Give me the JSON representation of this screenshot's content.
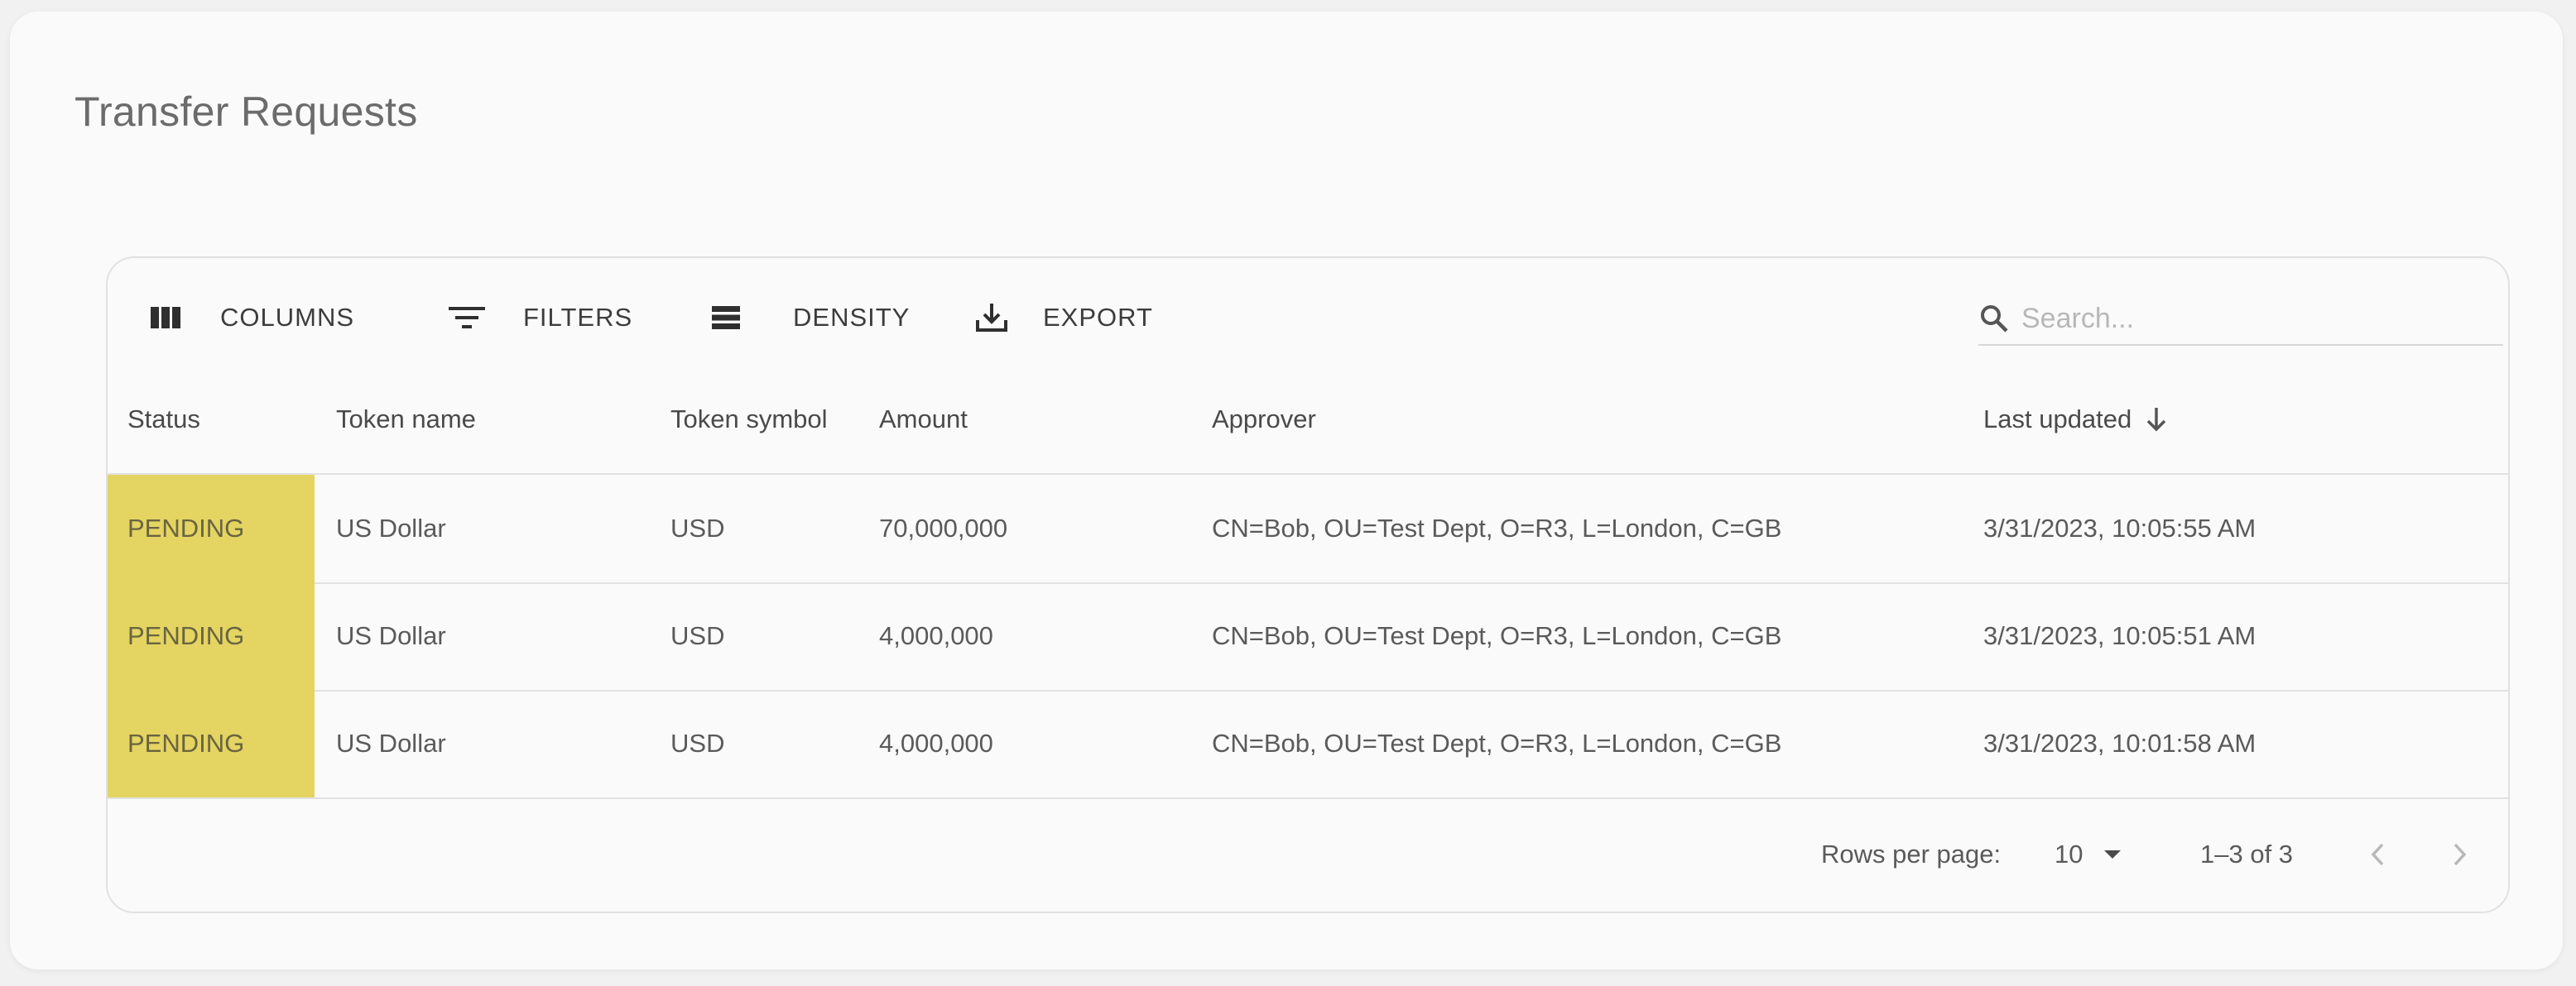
{
  "page": {
    "title": "Transfer Requests"
  },
  "toolbar": {
    "columns_label": "COLUMNS",
    "filters_label": "FILTERS",
    "density_label": "DENSITY",
    "export_label": "EXPORT",
    "search_placeholder": "Search..."
  },
  "table": {
    "headers": {
      "status": "Status",
      "token_name": "Token name",
      "token_symbol": "Token symbol",
      "amount": "Amount",
      "approver": "Approver",
      "last_updated": "Last updated"
    },
    "sort": {
      "column": "last_updated",
      "direction": "descending"
    },
    "rows": [
      {
        "status": "PENDING",
        "token_name": "US Dollar",
        "token_symbol": "USD",
        "amount": "70,000,000",
        "approver": "CN=Bob, OU=Test Dept, O=R3, L=London, C=GB",
        "last_updated": "3/31/2023, 10:05:55 AM"
      },
      {
        "status": "PENDING",
        "token_name": "US Dollar",
        "token_symbol": "USD",
        "amount": "4,000,000",
        "approver": "CN=Bob, OU=Test Dept, O=R3, L=London, C=GB",
        "last_updated": "3/31/2023, 10:05:51 AM"
      },
      {
        "status": "PENDING",
        "token_name": "US Dollar",
        "token_symbol": "USD",
        "amount": "4,000,000",
        "approver": "CN=Bob, OU=Test Dept, O=R3, L=London, C=GB",
        "last_updated": "3/31/2023, 10:01:58 AM"
      }
    ]
  },
  "pagination": {
    "rows_per_page_label": "Rows per page:",
    "rows_per_page_value": "10",
    "range_text": "1–3 of 3"
  },
  "colors": {
    "pending_status_bg": "#e4d462",
    "card_bg": "#fafafa",
    "page_bg": "#f1f1f1",
    "border": "#e1e1e1"
  },
  "icons": {
    "columns": "view-column-icon",
    "filters": "filter-list-icon",
    "density": "density-icon",
    "export": "download-icon",
    "search": "search-icon",
    "sort": "arrow-downward-icon",
    "rows_dropdown": "caret-down-icon",
    "prev": "chevron-left-icon",
    "next": "chevron-right-icon"
  }
}
